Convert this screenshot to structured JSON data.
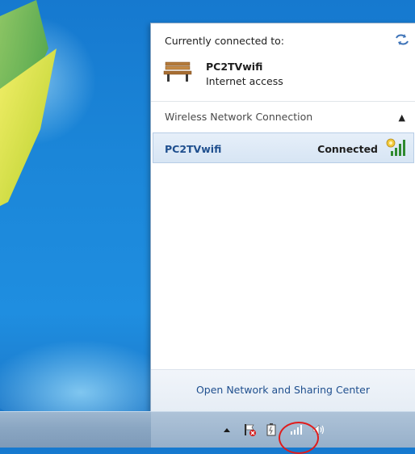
{
  "flyout": {
    "header": "Currently connected to:",
    "current_connection": {
      "name": "PC2TVwifi",
      "status": "Internet access",
      "icon": "bench-icon"
    },
    "section_title": "Wireless Network Connection",
    "networks": [
      {
        "name": "PC2TVwifi",
        "status": "Connected",
        "icon": "wifi-signal-icon"
      }
    ],
    "footer_link": "Open Network and Sharing Center"
  },
  "tray": {
    "icons": [
      "show-hidden-icons-arrow",
      "action-center-flag-icon",
      "power-icon",
      "network-signal-icon",
      "volume-icon"
    ]
  },
  "colors": {
    "link": "#1f4f8e",
    "highlight": "#d7e5f4",
    "annotation": "#e01c1c"
  }
}
